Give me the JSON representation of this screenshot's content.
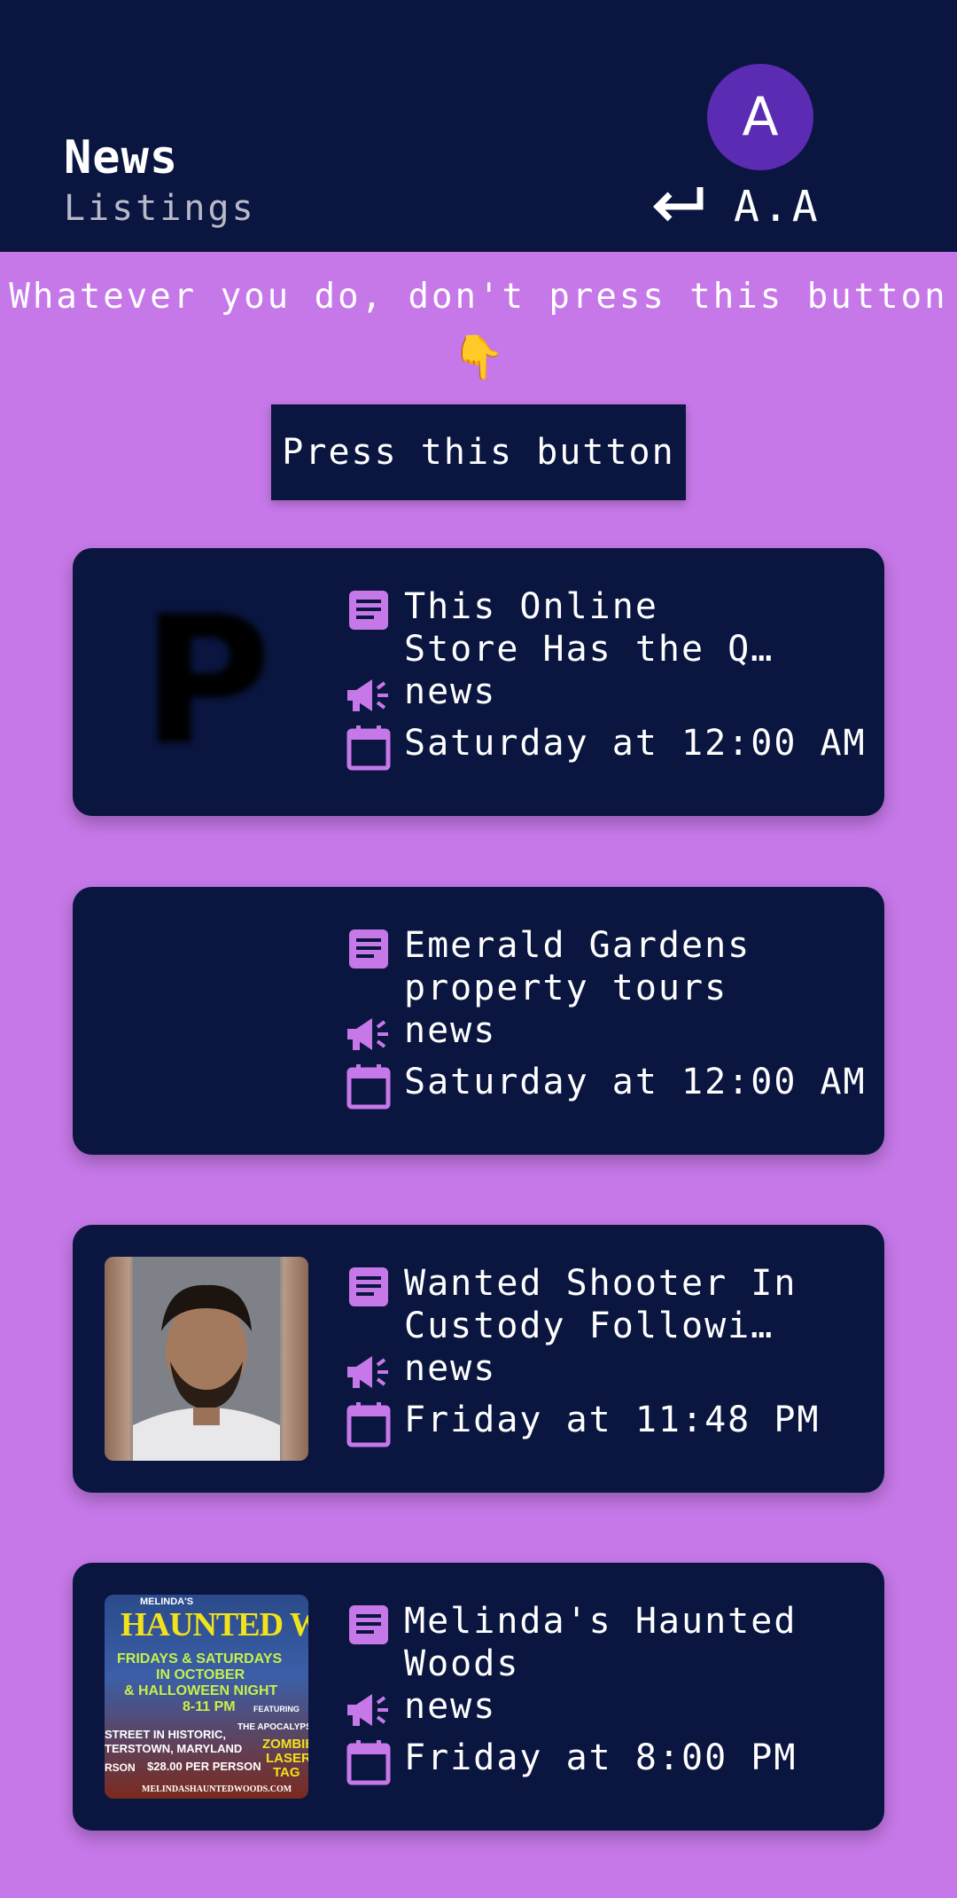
{
  "header": {
    "title": "News",
    "subtitle": "Listings",
    "avatar_letter": "A",
    "user_initials": "A.A"
  },
  "warning_text": "Whatever you do, don't press this button",
  "pointer_emoji": "👇",
  "press_button_label": "Press this button",
  "colors": {
    "background": "#c678e8",
    "navy": "#0a1640",
    "accent": "#c678e8",
    "avatar": "#5b2bb3"
  },
  "listings": [
    {
      "title": "This Online\nStore Has the Q…",
      "category": "news",
      "date": "Saturday at 12:00 AM",
      "thumbnail": "blurred-letter-p",
      "thumb_letter": "P"
    },
    {
      "title": "Emerald Gardens\nproperty tours",
      "category": "news",
      "date": "Saturday at 12:00 AM",
      "thumbnail": "none"
    },
    {
      "title": "Wanted Shooter In\nCustody Followi…",
      "category": "news",
      "date": "Friday at 11:48 PM",
      "thumbnail": "mugshot-photo"
    },
    {
      "title": "Melinda's Haunted\nWoods",
      "category": "news",
      "date": "Friday at 8:00 PM",
      "thumbnail": "haunted-woods-poster",
      "poster_text": {
        "brand": "MELINDA'S",
        "headline": "HAUNTED WO",
        "line1": "FRIDAYS & SATURDAYS",
        "line2": "IN OCTOBER",
        "line3": "& HALLOWEEN NIGHT",
        "line4": "8-11 PM",
        "featuring": "FEATURING",
        "apoc": "THE APOCALYPS",
        "zombie": "ZOMBIE",
        "laser": "LASER",
        "tag": "TAG",
        "street": "STREET IN HISTORIC,",
        "town": "TERSTOWN, MARYLAND",
        "price": "$28.00 PER PERSON",
        "rson": "RSON",
        "url": "MELINDASHAUNTEDWOODS.COM"
      }
    }
  ]
}
